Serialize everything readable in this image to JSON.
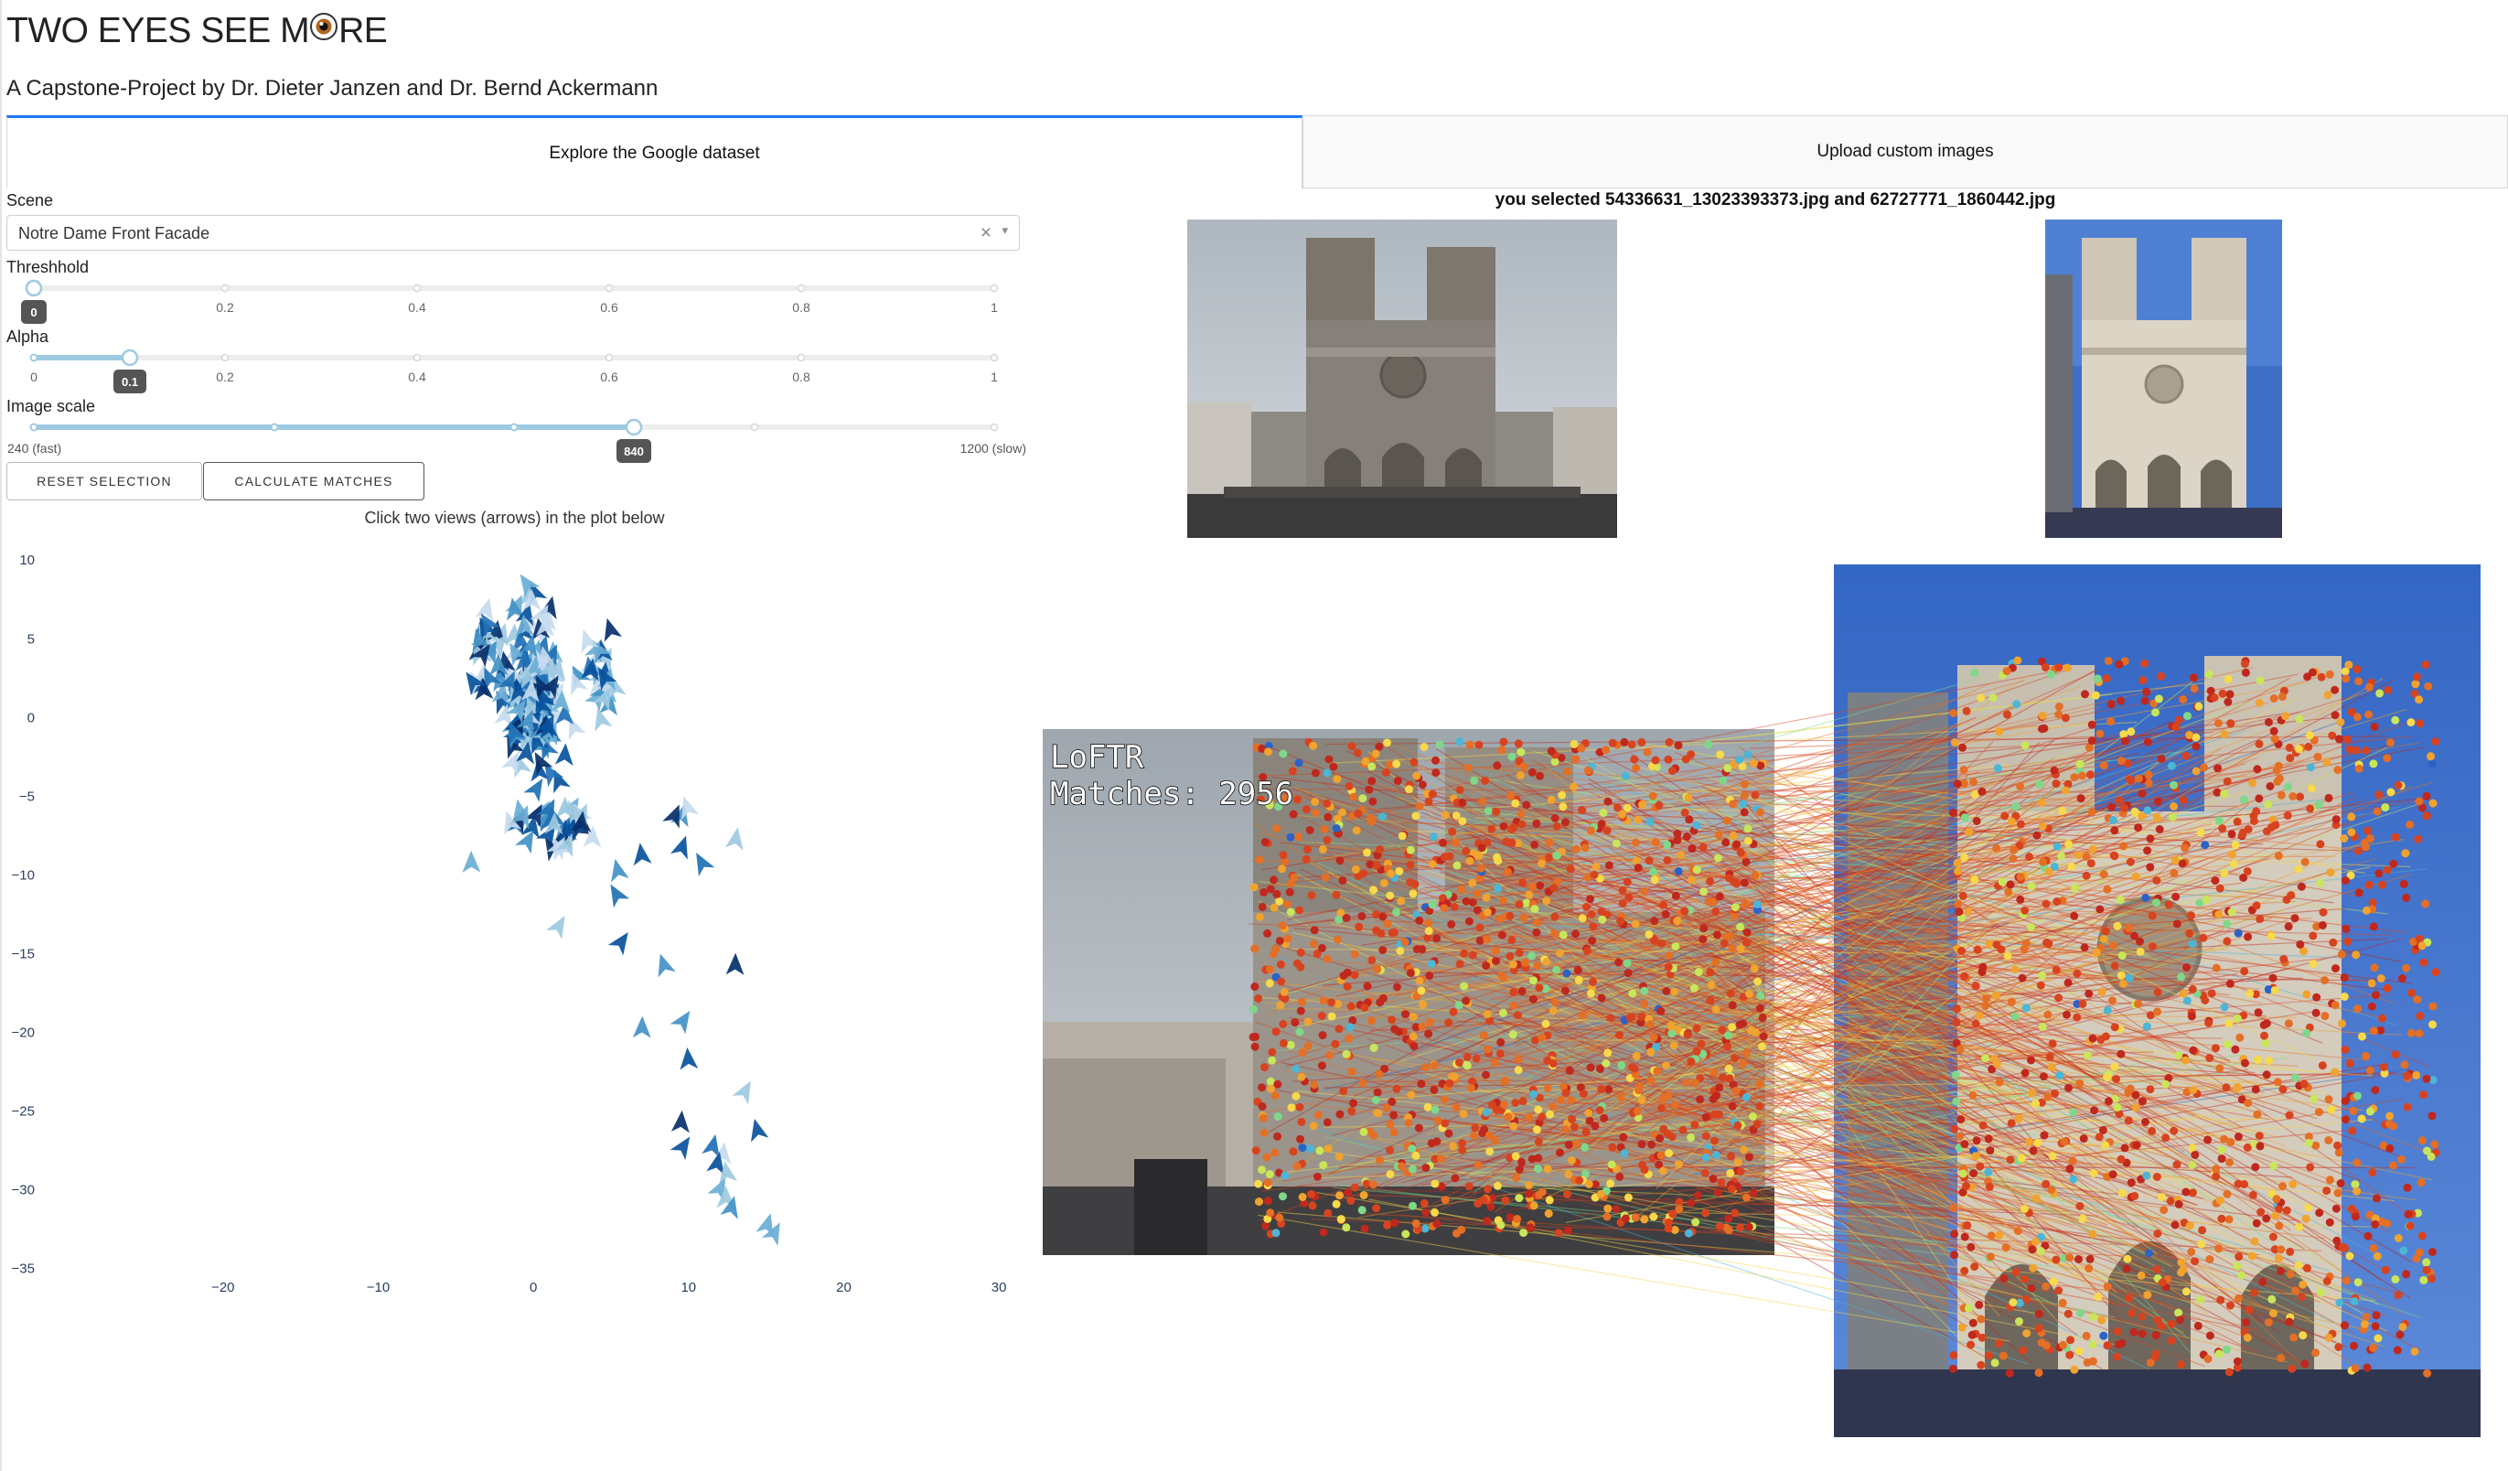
{
  "header": {
    "title_before": "TWO EYES SEE M",
    "title_after": "RE",
    "subtitle": "A Capstone-Project by Dr. Dieter Janzen and Dr. Bernd Ackermann"
  },
  "tabs": [
    {
      "label": "Explore the Google dataset",
      "active": true
    },
    {
      "label": "Upload custom images",
      "active": false
    }
  ],
  "controls": {
    "scene": {
      "label": "Scene",
      "value": "Notre Dame Front Facade",
      "clear_glyph": "×",
      "caret_glyph": "▾"
    },
    "threshold": {
      "label": "Threshhold",
      "value": 0,
      "value_label": "0",
      "min": 0,
      "max": 1,
      "ticks": [
        "0.2",
        "0.4",
        "0.6",
        "0.8",
        "1"
      ]
    },
    "alpha": {
      "label": "Alpha",
      "value": 0.1,
      "value_label": "0.1",
      "min": 0,
      "max": 1,
      "ticks": [
        "0",
        "0.2",
        "0.4",
        "0.6",
        "0.8",
        "1"
      ]
    },
    "image_scale": {
      "label": "Image scale",
      "value": 840,
      "value_label": "840",
      "min": 240,
      "max": 1200,
      "min_label": "240 (fast)",
      "max_label": "1200 (slow)"
    },
    "reset_button": "RESET SELECTION",
    "calc_button": "CALCULATE MATCHES"
  },
  "plot": {
    "title": "Click two views (arrows) in the plot below"
  },
  "chart_data": {
    "type": "scatter",
    "title": "Click two views (arrows) in the plot below",
    "marker": "arrow",
    "colors": [
      "#08306b",
      "#08519c",
      "#2171b5",
      "#4292c6",
      "#6baed6",
      "#9ecae1",
      "#c6dbef"
    ],
    "xlim": [
      -26,
      34
    ],
    "ylim": [
      -37,
      11
    ],
    "x_ticks": [
      -20,
      -10,
      0,
      10,
      20,
      30
    ],
    "y_ticks": [
      10,
      5,
      0,
      -5,
      -10,
      -15,
      -20,
      -25,
      -30,
      -35
    ],
    "x_tick_labels": [
      "−20",
      "−10",
      "0",
      "10",
      "20",
      "30"
    ],
    "y_tick_labels": [
      "10",
      "5",
      "0",
      "−5",
      "−10",
      "−15",
      "−20",
      "−25",
      "−30",
      "−35"
    ],
    "grid": false,
    "clusters": [
      {
        "cx": 0,
        "cy": 1.5,
        "sx": 1.8,
        "sy": 4.5,
        "n": 170
      },
      {
        "cx": -3,
        "cy": 3.5,
        "sx": 1.1,
        "sy": 2.2,
        "n": 25
      },
      {
        "cx": 4,
        "cy": 2,
        "sx": 1.2,
        "sy": 2.5,
        "n": 25
      },
      {
        "cx": 1,
        "cy": -7,
        "sx": 2.8,
        "sy": 1.5,
        "n": 35
      }
    ],
    "points": [
      {
        "x": -4,
        "y": -9.5
      },
      {
        "x": 5.5,
        "y": -10
      },
      {
        "x": 7,
        "y": -9
      },
      {
        "x": 9.5,
        "y": -6.5
      },
      {
        "x": 10,
        "y": -6
      },
      {
        "x": 9,
        "y": -6.5
      },
      {
        "x": 9.5,
        "y": -8.5
      },
      {
        "x": 11,
        "y": -9.5
      },
      {
        "x": 13,
        "y": -8
      },
      {
        "x": 5.5,
        "y": -11.5
      },
      {
        "x": 1.5,
        "y": -13.5
      },
      {
        "x": 5.5,
        "y": -14.5
      },
      {
        "x": 8.5,
        "y": -16
      },
      {
        "x": 13,
        "y": -16
      },
      {
        "x": 7,
        "y": -20
      },
      {
        "x": 9.5,
        "y": -19.5
      },
      {
        "x": 10,
        "y": -22
      },
      {
        "x": 13.5,
        "y": -24
      },
      {
        "x": 9.5,
        "y": -26
      },
      {
        "x": 14.5,
        "y": -26.5
      },
      {
        "x": 9.5,
        "y": -27.5
      },
      {
        "x": 11.5,
        "y": -27.5
      },
      {
        "x": 12.2,
        "y": -28
      },
      {
        "x": 11.8,
        "y": -28.6
      },
      {
        "x": 12.5,
        "y": -29.2
      },
      {
        "x": 11.9,
        "y": -30.2
      },
      {
        "x": 12.4,
        "y": -30.8
      },
      {
        "x": 12.7,
        "y": -31.4
      },
      {
        "x": 15,
        "y": -32.5
      },
      {
        "x": 15.4,
        "y": -33
      }
    ]
  },
  "selection": {
    "text": "you selected 54336631_13023393373.jpg and 62727771_1860442.jpg"
  },
  "matches": {
    "method": "LoFTR",
    "count_label": "Matches: 2956"
  }
}
